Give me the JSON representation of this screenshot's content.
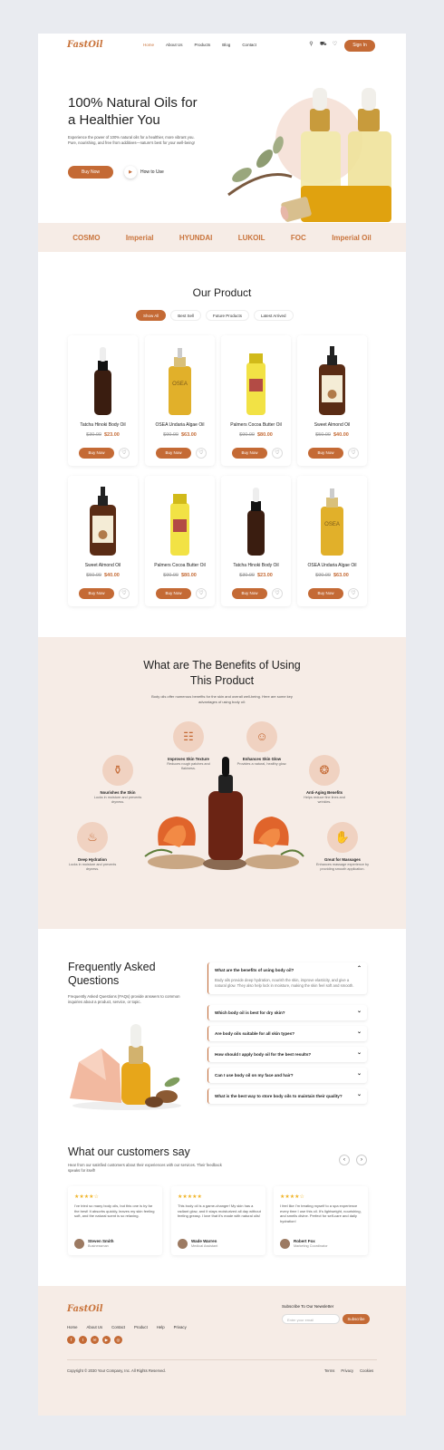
{
  "header": {
    "logo": "FastOil",
    "nav": [
      "Home",
      "About Us",
      "Products",
      "Blog",
      "Contact"
    ],
    "sign_in": "Sign In"
  },
  "hero": {
    "title": "100% Natural Oils for a Healthier You",
    "description": "Experience the power of 100% natural oils for a healthier, more vibrant you. Pure, nourishing, and free from additives—nature's best for your well-being!",
    "buy_now": "Buy Now",
    "how_to_use": "How to Use"
  },
  "brands": [
    "COSMO",
    "Imperial",
    "HYUNDAI",
    "LUKOIL",
    "FOC",
    "Imperial Oil"
  ],
  "products": {
    "title": "Our Product",
    "tabs": [
      "Show All",
      "Best Sell",
      "Future Products",
      "Latest Arrived"
    ],
    "items": [
      {
        "name": "Tatcha Hinoki Body Oil",
        "old": "$30.00",
        "new": "$23.00"
      },
      {
        "name": "OSEA Undaria Algae Oil",
        "old": "$90.00",
        "new": "$63.00"
      },
      {
        "name": "Palmers Cocoa Butter Oil",
        "old": "$90.00",
        "new": "$80.00"
      },
      {
        "name": "Sweet Almond Oil",
        "old": "$50.00",
        "new": "$40.00"
      },
      {
        "name": "Sweet Almond Oil",
        "old": "$50.00",
        "new": "$40.00"
      },
      {
        "name": "Palmers Cocoa Butter Oil",
        "old": "$90.00",
        "new": "$80.00"
      },
      {
        "name": "Tatcha Hinoki Body Oil",
        "old": "$30.00",
        "new": "$23.00"
      },
      {
        "name": "OSEA Undaria Algae Oil",
        "old": "$90.00",
        "new": "$63.00"
      }
    ],
    "buy_label": "Buy Now"
  },
  "benefits": {
    "title": "What are The Benefits of Using This Product",
    "description": "Body oils offer numerous benefits for the skin and overall well-being. Here are some key advantages of using body oil:",
    "items": [
      {
        "title": "Improves Skin Texture",
        "desc": "Reduces rough patches and flakiness."
      },
      {
        "title": "Enhances Skin Glow",
        "desc": "Provides a natural, healthy glow."
      },
      {
        "title": "Nourishes the Skin",
        "desc": "Locks in moisture and prevents dryness."
      },
      {
        "title": "Anti-Aging Benefits",
        "desc": "Helps reduce fine lines and wrinkles."
      },
      {
        "title": "Deep Hydration",
        "desc": "Locks in moisture and prevents dryness."
      },
      {
        "title": "Great for Massages",
        "desc": "Enhances massage experience by providing smooth application."
      }
    ]
  },
  "faq": {
    "title": "Frequently Asked Questions",
    "description": "Frequently Asked Questions (FAQs) provide answers to common inquiries about a product, service, or topic.",
    "items": [
      {
        "q": "What are the benefits of using body oil?",
        "a": "Body oils provide deep hydration, nourish the skin, improve elasticity, and give a natural glow. They also help lock in moisture, making the skin feel soft and smooth."
      },
      {
        "q": "Which body oil is best for dry skin?"
      },
      {
        "q": "Are body oils suitable for all skin types?"
      },
      {
        "q": "How should I apply body oil for the best results?"
      },
      {
        "q": "Can I use body oil on my face and hair?"
      },
      {
        "q": "What is the best way to store body oils to maintain their quality?"
      }
    ]
  },
  "testimonials": {
    "title": "What our customers say",
    "description": "Hear from our satisfied customers about their experiences with our services. Their feedback speaks for itself!",
    "items": [
      {
        "stars": "★★★★☆",
        "quote": "I've tried so many body oils, but this one is by far the best! It absorbs quickly, leaves my skin feeling soft, and the natural scent is so relaxing.",
        "name": "Steven Smith",
        "role": "Businessman"
      },
      {
        "stars": "★★★★★",
        "quote": "This body oil is a game-changer! My skin has a radiant glow, and it stays moisturized all day without feeling greasy. I love that it's made with natural oils!",
        "name": "Wade Warren",
        "role": "Medical Assistant"
      },
      {
        "stars": "★★★★☆",
        "quote": "I feel like I'm treating myself to a spa experience every time I use this oil. It's lightweight, nourishing, and smells divine. Perfect for self-care and daily hydration!",
        "name": "Robert Fox",
        "role": "Marketing Coordinator"
      }
    ]
  },
  "footer": {
    "logo": "FastOil",
    "nav": [
      "Home",
      "About Us",
      "Contact",
      "Product",
      "Help",
      "Privacy"
    ],
    "newsletter_label": "Subscribe To Our Newsletter",
    "email_placeholder": "Enter your email",
    "subscribe": "Subscribe",
    "copyright": "Copyright © 2030 Your Company, Inc. All Rights Reserved.",
    "legal": [
      "Terms",
      "Privacy",
      "Cookies"
    ]
  },
  "colors": {
    "accent": "#c46a35",
    "section_bg": "#f6ece6",
    "page_bg": "#e9ebf0"
  }
}
